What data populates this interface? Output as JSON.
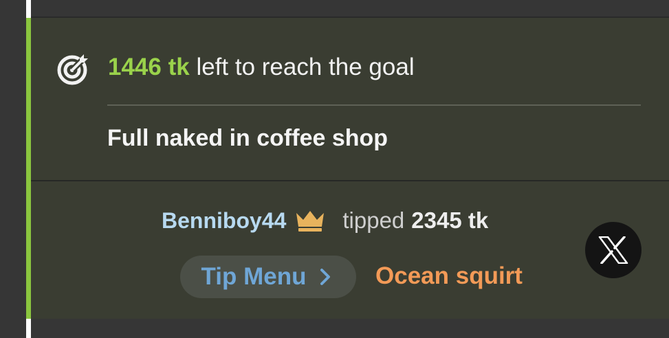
{
  "goal": {
    "amount": "1446 tk",
    "text": " left to reach the goal",
    "title": "Full naked in coffee shop"
  },
  "last_tip": {
    "user": "Benniboy44",
    "verb": "tipped",
    "amount": "2345 tk"
  },
  "tip_menu": {
    "label": "Tip Menu",
    "item": "Ocean squirt"
  },
  "colors": {
    "accent": "#8bc63f",
    "goal_amount": "#9ad24b",
    "username": "#b7d9f0",
    "crown": "#e8b35d",
    "tip_menu": "#6fa6d6",
    "tip_item": "#f39a57",
    "panel": "#3a3d32"
  },
  "icons": {
    "goal": "target-icon",
    "rank": "crown-icon",
    "menu": "chevron-right-icon",
    "social": "x-logo-icon"
  }
}
